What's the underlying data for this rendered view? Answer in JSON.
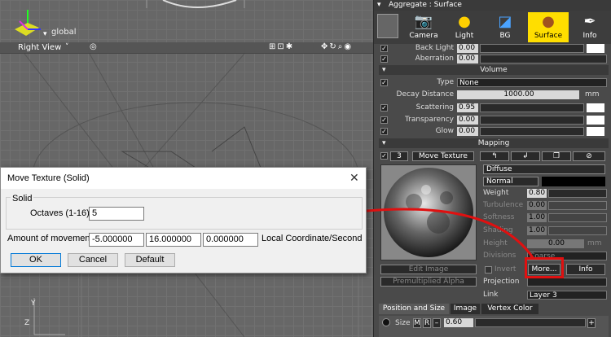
{
  "viewport_top": {
    "label": "global"
  },
  "viewport_right": {
    "title": "Right View",
    "menu_arrow": "˅",
    "axis_y": "Y",
    "axis_z": "Z"
  },
  "panel": {
    "title": "Aggregate : Surface",
    "tabs": [
      {
        "label": "Camera",
        "icon": "camera-icon"
      },
      {
        "label": "Light",
        "icon": "sun-icon"
      },
      {
        "label": "BG",
        "icon": "bg-icon"
      },
      {
        "label": "Surface",
        "icon": "sphere-icon"
      },
      {
        "label": "Info",
        "icon": "info-icon"
      }
    ],
    "back_light": {
      "label": "Back Light",
      "value": "0.00"
    },
    "aberration": {
      "label": "Aberration",
      "value": "0.00"
    },
    "volume_header": "Volume",
    "type": {
      "label": "Type",
      "value": "None"
    },
    "decay": {
      "label": "Decay Distance",
      "value": "1000.00",
      "unit": "mm"
    },
    "scattering": {
      "label": "Scattering",
      "value": "0.95"
    },
    "transparency": {
      "label": "Transparency",
      "value": "0.00"
    },
    "glow": {
      "label": "Glow",
      "value": "0.00"
    },
    "mapping_header": "Mapping",
    "mapping": {
      "index": "3",
      "mode": "Move Texture"
    },
    "diffuse": "Diffuse",
    "blend": "Normal",
    "weight": {
      "label": "Weight",
      "value": "0.80"
    },
    "turbulence": {
      "label": "Turbulence",
      "value": "0.00"
    },
    "softness": {
      "label": "Softness",
      "value": "1.00"
    },
    "shading": {
      "label": "Shading",
      "value": "1.00"
    },
    "height": {
      "label": "Height",
      "value": "0.00",
      "unit": "mm"
    },
    "divisions": {
      "label": "Divisions",
      "value": "Coarse"
    },
    "edit_image": "Edit Image",
    "premultiplied_alpha": "Premultiplied Alpha",
    "invert": "Invert",
    "more_button": "More...",
    "info_button": "Info",
    "projection": {
      "label": "Projection",
      "value": ""
    },
    "link": {
      "label": "Link",
      "value": "Layer 3"
    },
    "bottom_tabs": [
      "Position and Size",
      "Image",
      "Vertex Color"
    ],
    "size": {
      "label": "Size",
      "m": "M",
      "r": "R",
      "value": "0.60"
    },
    "colors": {
      "accent": "#ffde00",
      "highlight_red": "#e01010"
    }
  },
  "dialog": {
    "title": "Move Texture (Solid)",
    "close": "✕",
    "group_label": "Solid",
    "octaves_label": "Octaves (1-16)",
    "octaves_value": "5",
    "movement_label": "Amount of movement",
    "movement_x": "-5.000000",
    "movement_y": "16.000000",
    "movement_z": "0.000000",
    "coordinate_label": "Local Coordinate/Second",
    "ok": "OK",
    "cancel": "Cancel",
    "default": "Default"
  }
}
